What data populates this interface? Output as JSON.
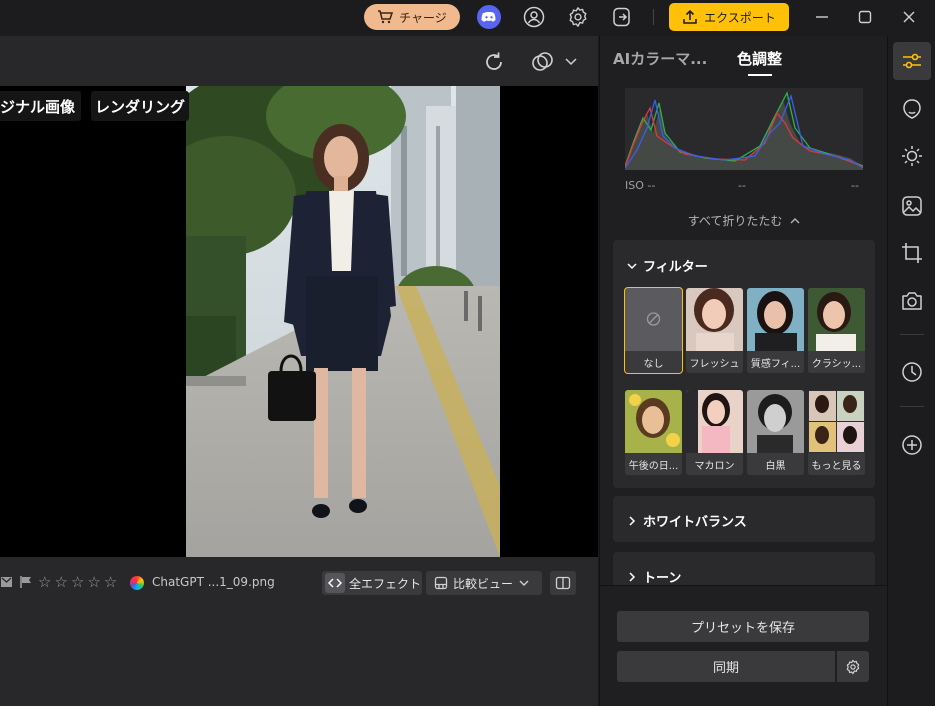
{
  "topbar": {
    "charge_label": "チャージ",
    "export_label": "エクスポート"
  },
  "main": {
    "tag_original": "ジナル画像",
    "tag_rendering": "レンダリング",
    "filename": "ChatGPT ...1_09.png",
    "effects_label": "全エフェクト",
    "compare_label": "比較ビュー",
    "rating_stars": 0
  },
  "panel": {
    "tabs": [
      "AIカラーマ...",
      "色調整"
    ],
    "active_tab": "色調整",
    "iso_label": "ISO --",
    "iso_mid": "--",
    "iso_right": "--",
    "collapse_all": "すべて折りたたむ",
    "filter_section": "フィルター",
    "filters": [
      "なし",
      "フレッシュ",
      "質感フィ...",
      "クラシッ...",
      "午後の日...",
      "マカロン",
      "白黒",
      "もっと見る"
    ],
    "white_balance": "ホワイトバランス",
    "tone": "トーン",
    "save_preset": "プリセットを保存",
    "sync": "同期"
  },
  "colors": {
    "accent": "#ffc107",
    "charge": "#f0b98e",
    "discord": "#5865f2"
  }
}
